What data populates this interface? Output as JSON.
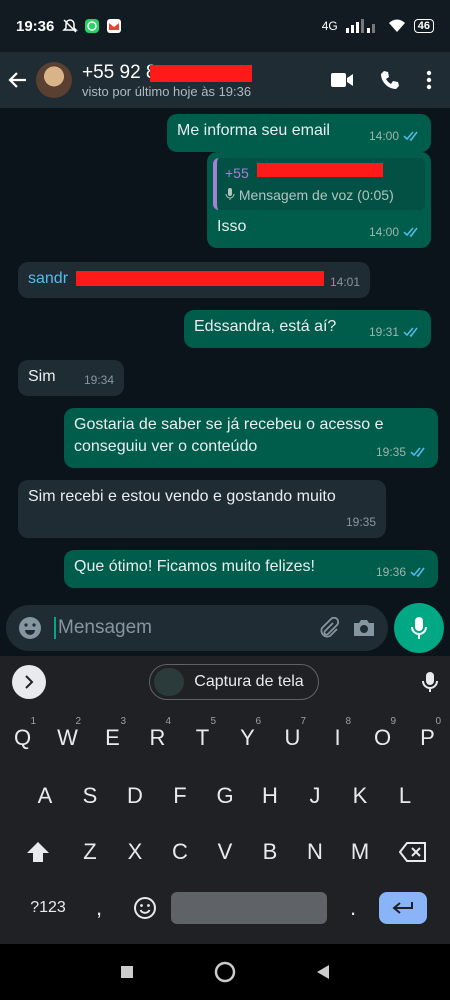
{
  "statusbar": {
    "time": "19:36",
    "network": "4G",
    "battery": "46"
  },
  "header": {
    "contact_name": "+55 92 8",
    "last_seen": "visto por último hoje às 19:36"
  },
  "messages": [
    {
      "text": "Me informa seu email",
      "time": "14:00",
      "direction": "out"
    },
    {
      "quote_name": "+55",
      "quote_text": "Mensagem de voz (0:05)",
      "text": "Isso",
      "time": "14:00",
      "direction": "out"
    },
    {
      "text": "sandr",
      "time": "14:01",
      "direction": "in"
    },
    {
      "text": "Edssandra, está aí?",
      "time": "19:31",
      "direction": "out"
    },
    {
      "text": "Sim",
      "time": "19:34",
      "direction": "in"
    },
    {
      "text": "Gostaria de saber se já recebeu o acesso e conseguiu ver o conteúdo",
      "time": "19:35",
      "direction": "out"
    },
    {
      "text": "Sim recebi e estou vendo e gostando muito",
      "time": "19:35",
      "direction": "in"
    },
    {
      "text": "Que ótimo! Ficamos muito felizes!",
      "time": "19:36",
      "direction": "out"
    }
  ],
  "input": {
    "placeholder": "Mensagem"
  },
  "keyboard": {
    "suggestion_chip": "Captura de tela",
    "row1": [
      "Q",
      "W",
      "E",
      "R",
      "T",
      "Y",
      "U",
      "I",
      "O",
      "P"
    ],
    "row1_hints": [
      "1",
      "2",
      "3",
      "4",
      "5",
      "6",
      "7",
      "8",
      "9",
      "0"
    ],
    "row2": [
      "A",
      "S",
      "D",
      "F",
      "G",
      "H",
      "J",
      "K",
      "L"
    ],
    "row3": [
      "Z",
      "X",
      "C",
      "V",
      "B",
      "N",
      "M"
    ],
    "symbols_label": "?123",
    "comma": ",",
    "period": "."
  },
  "colors": {
    "accent": "#00a884",
    "outgoing_bubble": "#005c4b",
    "incoming_bubble": "#1f2c34",
    "redaction": "#ff1a1a"
  }
}
